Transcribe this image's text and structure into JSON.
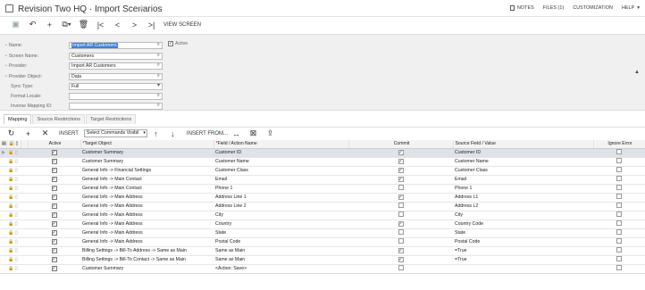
{
  "header": {
    "title": "Revision Two HQ · Import Scenarios",
    "menu": {
      "notes": "NOTES",
      "files": "FILES (1)",
      "customization": "CUSTOMIZATION",
      "help": "HELP"
    }
  },
  "toolbar": {
    "view_screen": "VIEW SCREEN"
  },
  "form": {
    "name_label": "Name:",
    "name_value": "Import AR Customers",
    "active_label": "Active",
    "active_checked": true,
    "screen_name_label": "Screen Name:",
    "screen_name_value": "Customers",
    "provider_label": "Provider:",
    "provider_value": "Import AR Customers",
    "provider_object_label": "Provider Object:",
    "provider_object_value": "Data",
    "sync_type_label": "Sync Type:",
    "sync_type_value": "Full",
    "format_locale_label": "Format Locale:",
    "format_locale_value": "",
    "inverse_mapping_label": "Inverse Mapping ID:",
    "inverse_mapping_value": ""
  },
  "tabs": [
    "Mapping",
    "Source Restrictions",
    "Target Restrictions"
  ],
  "grid_toolbar": {
    "insert": "INSERT",
    "commands": "Select Commands Visibil",
    "insert_from": "INSERT FROM..."
  },
  "columns": {
    "active": "Active",
    "target_object": "Target Object",
    "field_action": "Field / Action Name",
    "commit": "Commit",
    "source_field": "Source Field / Value",
    "ignore_error": "Ignore Error"
  },
  "rows": [
    {
      "target": "Customer Summary",
      "field": "Customer ID",
      "commit": true,
      "source": "Customer ID",
      "selected": true
    },
    {
      "target": "Customer Summary",
      "field": "Customer Name",
      "commit": true,
      "source": "Customer Name"
    },
    {
      "target": "General Info -> Financial Settings",
      "field": "Customer Class",
      "commit": true,
      "source": "Customer Class"
    },
    {
      "target": "General Info -> Main Contact",
      "field": "Email",
      "commit": true,
      "source": "Email"
    },
    {
      "target": "General Info -> Main Contact",
      "field": "Phone 1",
      "commit": false,
      "source": "Phone 1"
    },
    {
      "target": "General Info -> Main Address",
      "field": "Address Line 1",
      "commit": true,
      "source": "Address L1"
    },
    {
      "target": "General Info -> Main Address",
      "field": "Address Line 2",
      "commit": false,
      "source": "Address L2"
    },
    {
      "target": "General Info -> Main Address",
      "field": "City",
      "commit": false,
      "source": "City"
    },
    {
      "target": "General Info -> Main Address",
      "field": "Country",
      "commit": true,
      "source": "Country Code"
    },
    {
      "target": "General Info -> Main Address",
      "field": "State",
      "commit": false,
      "source": "State"
    },
    {
      "target": "General Info -> Main Address",
      "field": "Postal Code",
      "commit": false,
      "source": "Postal Code"
    },
    {
      "target": "Billing Settings -> Bill-To Address -> Same as Main",
      "field": "Same as Main",
      "commit": true,
      "source": "=True"
    },
    {
      "target": "Billing Settings -> Bill-To Contact -> Same as Main",
      "field": "Same as Main",
      "commit": true,
      "source": "=True"
    },
    {
      "target": "Customer Summary",
      "field": "<Action: Save>",
      "commit": false,
      "source": ""
    }
  ]
}
